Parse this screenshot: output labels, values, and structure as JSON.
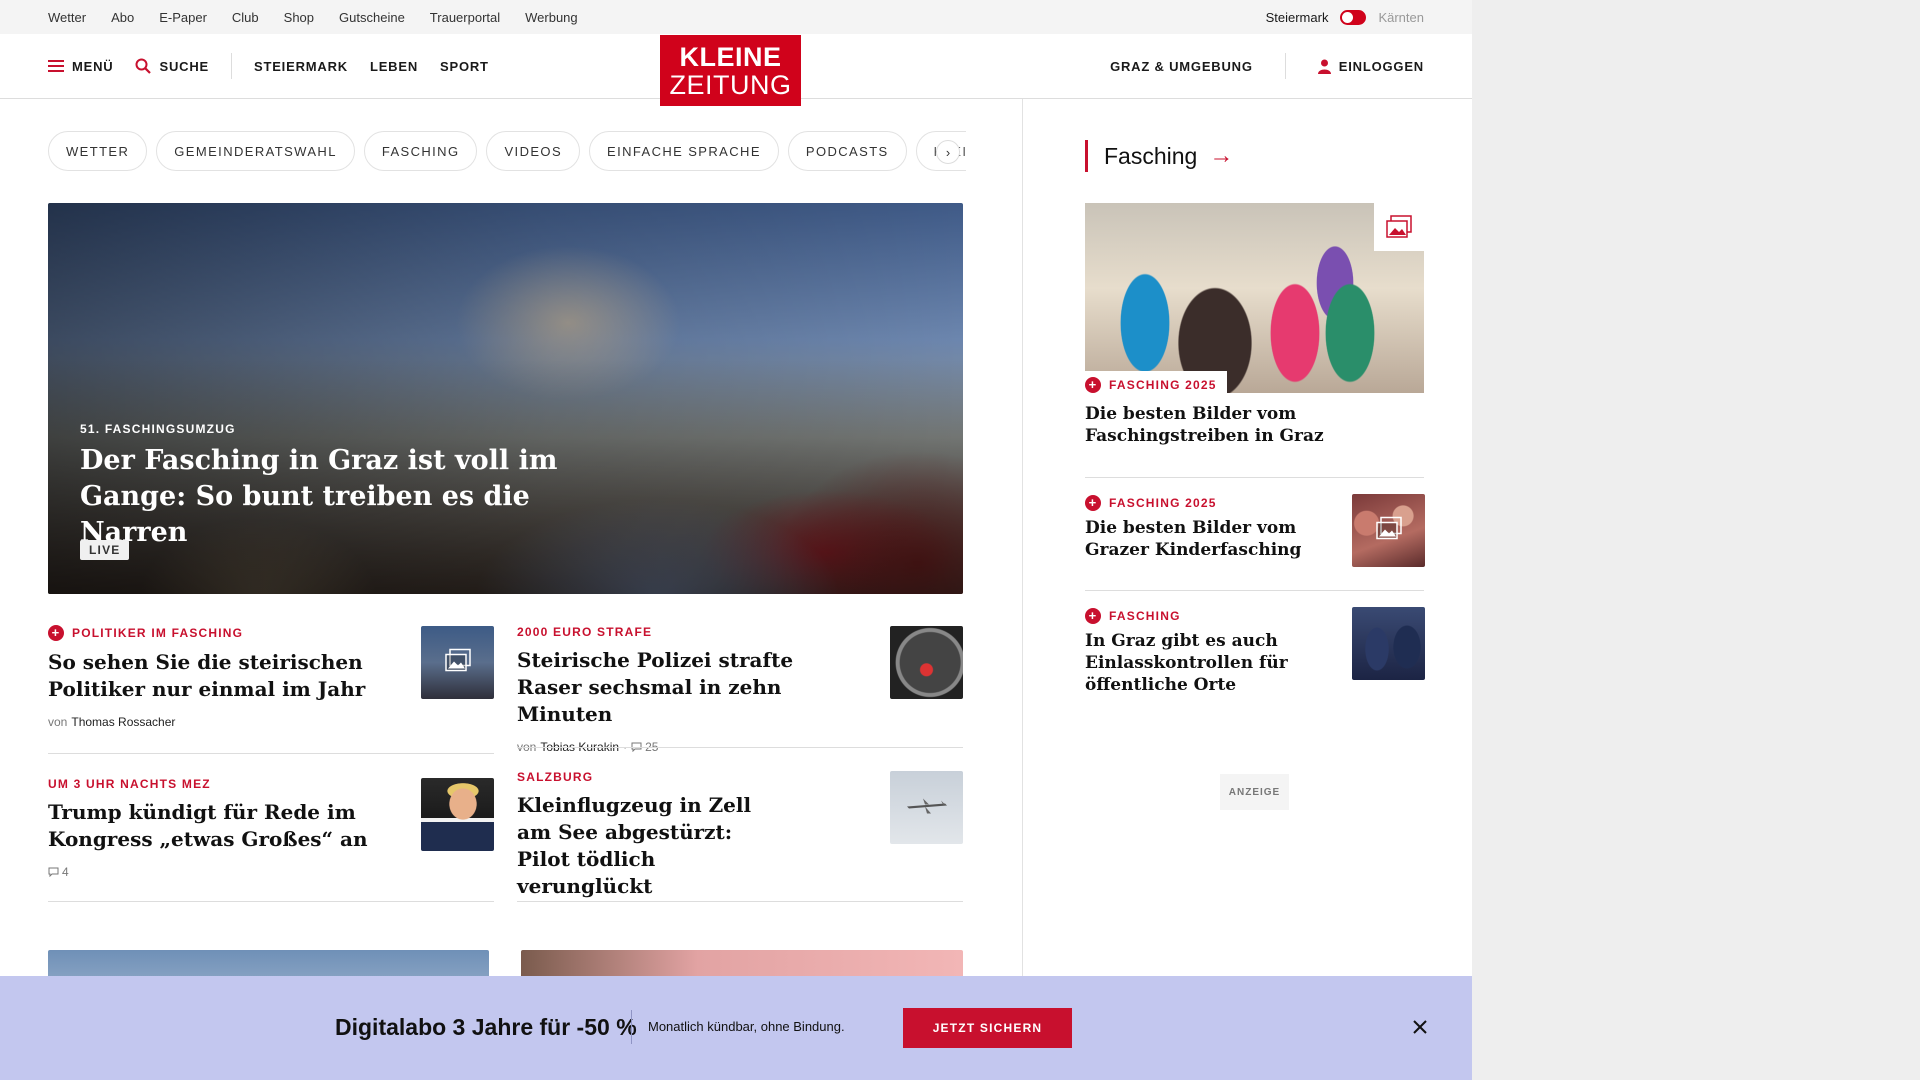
{
  "topbar": {
    "links": [
      "Wetter",
      "Abo",
      "E-Paper",
      "Club",
      "Shop",
      "Gutscheine",
      "Trauerportal",
      "Werbung"
    ],
    "region_active": "Steiermark",
    "region_inactive": "Kärnten"
  },
  "header": {
    "menu_label": "MENÜ",
    "search_label": "SUCHE",
    "nav": [
      "STEIERMARK",
      "LEBEN",
      "SPORT"
    ],
    "logo_line1": "KLEINE",
    "logo_line2": "ZEITUNG",
    "local_label": "GRAZ & UMGEBUNG",
    "login_label": "EINLOGGEN"
  },
  "pills": [
    "WETTER",
    "GEMEINDERATSWAHL",
    "FASCHING",
    "VIDEOS",
    "EINFACHE SPRACHE",
    "PODCASTS",
    "KLEINE KIN"
  ],
  "hero": {
    "kicker": "51. FASCHINGSUMZUG",
    "title": "Der Fasching in Graz ist voll im Gange: So bunt treiben es die Narren",
    "badge": "LIVE"
  },
  "articles": [
    {
      "kicker": "POLITIKER IM FASCHING",
      "premium": true,
      "title": "So sehen Sie die steirischen Politiker nur einmal im Jahr",
      "by_prefix": "von",
      "author": "Thomas Rossacher",
      "gallery": true
    },
    {
      "kicker": "2000 EURO STRAFE",
      "premium": false,
      "title": "Steirische Polizei strafte Raser sechsmal in zehn Minuten",
      "by_prefix": "von",
      "author": "Tobias Kurakin",
      "comments": "25"
    },
    {
      "kicker": "UM 3 UHR NACHTS MEZ",
      "premium": false,
      "title": "Trump kündigt für Rede im Kongress „etwas Großes“ an",
      "comments": "4"
    },
    {
      "kicker": "SALZBURG",
      "premium": false,
      "title": "Kleinflugzeug in Zell am See abgestürzt: Pilot tödlich verunglückt"
    }
  ],
  "sidebar": {
    "heading": "Fasching",
    "lead": {
      "kicker": "FASCHING 2025",
      "title": "Die besten Bilder vom Faschingstreiben in Graz"
    },
    "items": [
      {
        "kicker": "FASCHING 2025",
        "title": "Die besten Bilder vom Grazer Kinderfasching",
        "gallery": true
      },
      {
        "kicker": "FASCHING",
        "title": "In Graz gibt es auch Einlasskontrollen für öffentliche Orte"
      }
    ],
    "ad_label": "ANZEIGE"
  },
  "offer": {
    "headline": "Digitalabo 3 Jahre für -50 %",
    "subline": "Monatlich kündbar, ohne Bindung.",
    "cta": "JETZT SICHERN"
  },
  "colors": {
    "brand_red": "#d0021b",
    "kicker_red": "#c8102e",
    "offer_bg": "#c3c7ef"
  }
}
